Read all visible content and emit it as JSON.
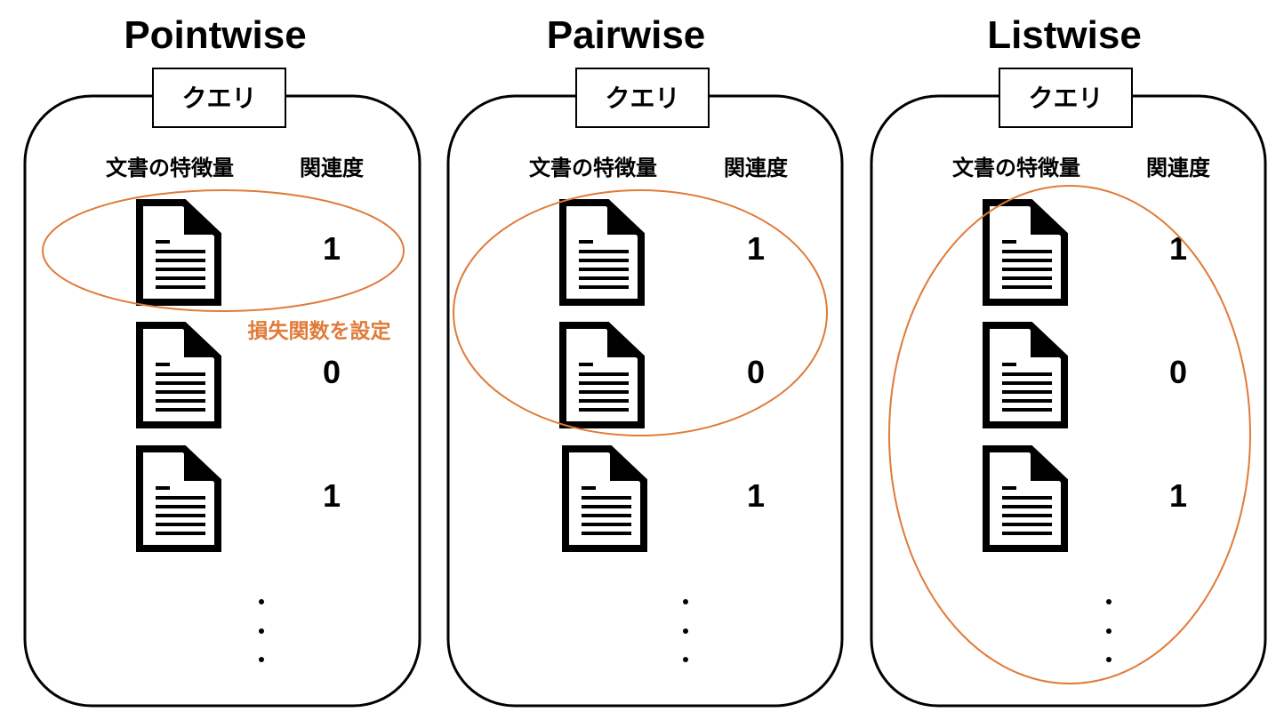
{
  "colors": {
    "highlight": "#E07B39",
    "ink": "#000000",
    "background": "#FFFFFF"
  },
  "panels": [
    {
      "title": "Pointwise",
      "query_label": "クエリ",
      "feature_header": "文書の特徴量",
      "relevance_header": "関連度",
      "documents": [
        {
          "icon": "document-icon",
          "relevance": "1"
        },
        {
          "icon": "document-icon",
          "relevance": "0"
        },
        {
          "icon": "document-icon",
          "relevance": "1"
        }
      ],
      "ellipsis": "⋮",
      "highlight_scope": "single document",
      "annotation": "損失関数を設定"
    },
    {
      "title": "Pairwise",
      "query_label": "クエリ",
      "feature_header": "文書の特徴量",
      "relevance_header": "関連度",
      "documents": [
        {
          "icon": "document-icon",
          "relevance": "1"
        },
        {
          "icon": "document-icon",
          "relevance": "0"
        },
        {
          "icon": "document-icon",
          "relevance": "1"
        }
      ],
      "ellipsis": "⋮",
      "highlight_scope": "document pair"
    },
    {
      "title": "Listwise",
      "query_label": "クエリ",
      "feature_header": "文書の特徴量",
      "relevance_header": "関連度",
      "documents": [
        {
          "icon": "document-icon",
          "relevance": "1"
        },
        {
          "icon": "document-icon",
          "relevance": "0"
        },
        {
          "icon": "document-icon",
          "relevance": "1"
        }
      ],
      "ellipsis": "⋮",
      "highlight_scope": "whole list"
    }
  ]
}
